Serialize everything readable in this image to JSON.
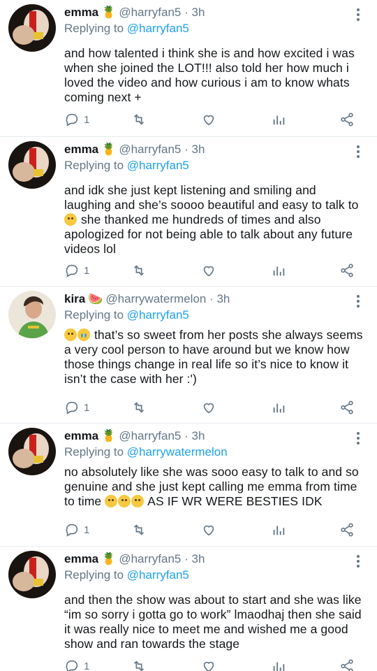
{
  "tweets": [
    {
      "name": "emma",
      "tag_emoji": "🍍",
      "handle": "@harryfan5",
      "time": "3h",
      "replying_prefix": "Replying to",
      "replying_to": "@harryfan5",
      "body": "and how talented i think she is and how excited i was when she joined the LOT!!! also told her how much i loved the video and how curious i am to know whats coming next +",
      "reply_count": "1"
    },
    {
      "name": "emma",
      "tag_emoji": "🍍",
      "handle": "@harryfan5",
      "time": "3h",
      "replying_prefix": "Replying to",
      "replying_to": "@harryfan5",
      "body_parts": [
        "and idk she just kept listening and smiling and laughing and she’s soooo beautiful and easy to talk to ",
        " she thanked me hundreds of times and also apologized for not being able to talk about any future videos lol"
      ],
      "reply_count": "1"
    },
    {
      "name": "kira",
      "tag_emoji": "🍉",
      "handle": "@harrywatermelon",
      "time": "3h",
      "replying_prefix": "Replying to",
      "replying_to": "@harryfan5",
      "body_parts": [
        "",
        " that’s so sweet from her posts she always seems a very cool person to have around but we know how those things change in real life so it’s nice to know it isn’t the case with her :')"
      ],
      "reply_count": "1"
    },
    {
      "name": "emma",
      "tag_emoji": "🍍",
      "handle": "@harryfan5",
      "time": "3h",
      "replying_prefix": "Replying to",
      "replying_to": "@harrywatermelon",
      "body_parts": [
        "no absolutely like she was sooo easy to talk to and so genuine and she just kept calling me emma from time to time ",
        " AS IF WR WERE BESTIES IDK"
      ],
      "reply_count": "1"
    },
    {
      "name": "emma",
      "tag_emoji": "🍍",
      "handle": "@harryfan5",
      "time": "3h",
      "replying_prefix": "Replying to",
      "replying_to": "@harryfan5",
      "body": "and then the show was about to start and she was like “im so sorry i gotta go to work” lmaodhaj then she said it was really nice to meet me and wished me a good show and ran towards the stage",
      "reply_count": "1"
    }
  ],
  "separator": "·",
  "colors": {
    "accent": "#1da1f2",
    "muted": "#657786",
    "text": "#14171a"
  },
  "icons": [
    "reply-icon",
    "retweet-icon",
    "like-icon",
    "analytics-icon",
    "share-icon",
    "more-icon"
  ]
}
